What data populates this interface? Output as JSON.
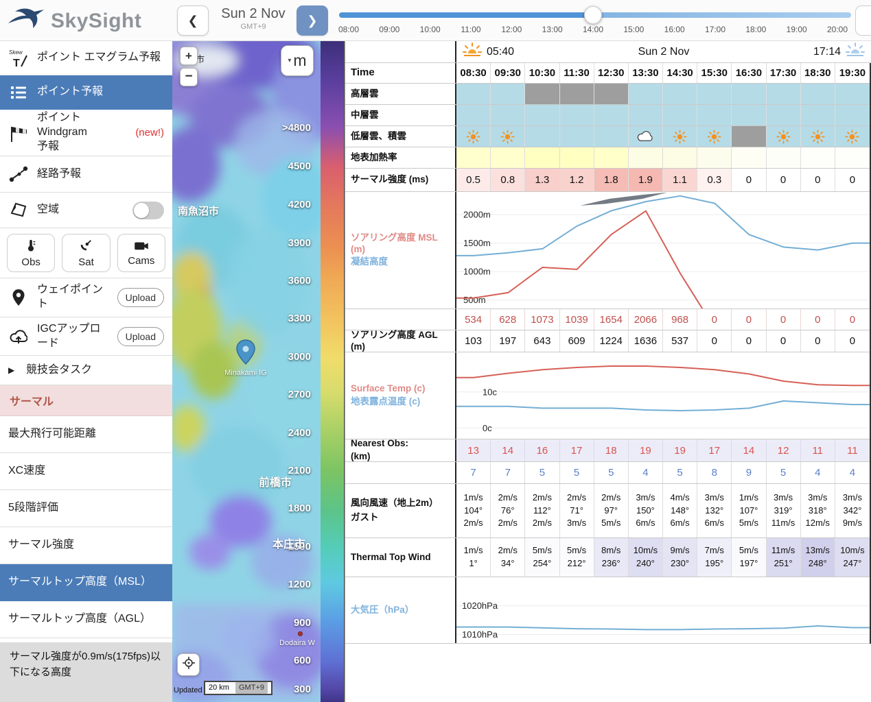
{
  "header": {
    "logo_text": "SkySight",
    "prev_label": "❮",
    "next_label": "❯",
    "date": "Sun 2 Nov",
    "timezone": "GMT+9",
    "slider": {
      "ticks": [
        "08:00",
        "09:00",
        "10:00",
        "11:00",
        "12:00",
        "13:00",
        "14:00",
        "15:00",
        "16:00",
        "17:00",
        "18:00",
        "19:00",
        "20:00"
      ],
      "value": "14:00"
    }
  },
  "sidebar": {
    "emagram": "ポイント エマグラム予報",
    "point_forecast": "ポイント予報",
    "windgram_line1": "ポイント Windgram",
    "windgram_line2": "予報",
    "windgram_new": "(new!)",
    "route": "経路予報",
    "airspace": "空域",
    "obs": "Obs",
    "sat": "Sat",
    "cams": "Cams",
    "waypoint": "ウェイポイント",
    "upload": "Upload",
    "igc": "IGCアップロード",
    "task_arrow": "▶",
    "task": "競技会タスク",
    "thermal_header": "サーマル",
    "max_distance": "最大飛行可能距離",
    "xc_speed": "XC速度",
    "rating": "5段階評価",
    "thermal_strength": "サーマル強度",
    "thermal_top_msl": "サーマルトップ高度（MSL）",
    "thermal_top_agl": "サーマルトップ高度（AGL）",
    "footer_note": "サーマル強度が0.9m/s(175fps)以下になる高度"
  },
  "map": {
    "zoom_in": "+",
    "zoom_out": "−",
    "unit_button": "m",
    "labels": {
      "city_top": "市",
      "minamiuonuma": "南魚沼市",
      "minakami": "Minakami IG",
      "maebashi": "前橋市",
      "honjo": "本庄市",
      "dodaira": "Dodaira W"
    },
    "updated_label": "Updated",
    "updated_chip": "GMT+9",
    "scalebar": "20 km",
    "scale_labels": [
      ">4800",
      "4500",
      "4200",
      "3900",
      "3600",
      "3300",
      "3000",
      "2700",
      "2400",
      "2100",
      "1800",
      "1500",
      "1200",
      "900",
      "600",
      "300"
    ]
  },
  "forecast": {
    "sunrise_time": "05:40",
    "date": "Sun 2 Nov",
    "sunset_time": "17:14",
    "times": [
      "08:30",
      "09:30",
      "10:30",
      "11:30",
      "12:30",
      "13:30",
      "14:30",
      "15:30",
      "16:30",
      "17:30",
      "18:30",
      "19:30"
    ],
    "rows": [
      {
        "key": "time",
        "height": 30,
        "cls": "time",
        "labels": [
          {
            "text": "Time",
            "size": 15
          }
        ],
        "use_times": true
      },
      {
        "key": "high_cloud",
        "height": 31,
        "labels": [
          {
            "text": "高層雲"
          }
        ],
        "cellbgs": [
          "#b5dbe7",
          "#b5dbe7",
          "#9e9e9e",
          "#9e9e9e",
          "#9e9e9e",
          "#b5dbe7",
          "#b5dbe7",
          "#b5dbe7",
          "#b5dbe7",
          "#b5dbe7",
          "#b5dbe7",
          "#b5dbe7"
        ]
      },
      {
        "key": "mid_cloud",
        "height": 31,
        "labels": [
          {
            "text": "中層雲"
          }
        ],
        "cellbgs": [
          "#b5dbe7",
          "#b5dbe7",
          "#b5dbe7",
          "#b5dbe7",
          "#b5dbe7",
          "#b5dbe7",
          "#b5dbe7",
          "#b5dbe7",
          "#b5dbe7",
          "#b5dbe7",
          "#b5dbe7",
          "#b5dbe7"
        ]
      },
      {
        "key": "low_cloud",
        "height": 31,
        "labels": [
          {
            "text": "低層雲、積雲"
          }
        ],
        "cellbgs": [
          "#b5dbe7",
          "#b5dbe7",
          "#b5dbe7",
          "#b5dbe7",
          "#b5dbe7",
          "#b5dbe7",
          "#b5dbe7",
          "#b5dbe7",
          "#9e9e9e",
          "#b5dbe7",
          "#b5dbe7",
          "#b5dbe7"
        ],
        "icons": [
          "sun",
          "sun",
          null,
          null,
          null,
          "cloud",
          "sun",
          "sun",
          null,
          "sun",
          "sun",
          "sun"
        ]
      },
      {
        "key": "heating",
        "height": 31,
        "labels": [
          {
            "text": "地表加熱率"
          }
        ],
        "cellbgs": [
          "#ffffce",
          "#ffffce",
          "#ffffc2",
          "#ffffc2",
          "#ffffca",
          "#fdfce4",
          "#fdfce4",
          "#fdfdee",
          "#fefef4",
          "#fefef8",
          "#fefefa",
          "#fefefa"
        ]
      },
      {
        "key": "strength",
        "height": 34,
        "cls": "vals",
        "labels": [
          {
            "text": "サーマル強度 (ms)"
          }
        ],
        "values": [
          "0.5",
          "0.8",
          "1.3",
          "1.2",
          "1.8",
          "1.9",
          "1.1",
          "0.3",
          "0",
          "0",
          "0",
          "0"
        ],
        "cellbgs": [
          "#fcebe9",
          "#fbe0dd",
          "#f8cfca",
          "#f9d2cd",
          "#f5bcb5",
          "#f5b9b2",
          "#f9d6d1",
          "#fdf2f0",
          "#ffffff",
          "#ffffff",
          "#ffffff",
          "#ffffff"
        ]
      },
      {
        "key": "soaring_chart",
        "type": "chart",
        "chart": "soaring",
        "height": 171,
        "labels": [
          {
            "text": "ソアリング高度 MSL (m)",
            "color": "#e08a85"
          },
          {
            "text": "凝結高度",
            "color": "#7fb2dd"
          }
        ]
      },
      {
        "key": "msl_values",
        "height": 31,
        "cls": "vals",
        "fg": "#c0504d",
        "border": "#ecd6d4",
        "labels": [],
        "values": [
          "534",
          "628",
          "1073",
          "1039",
          "1654",
          "2066",
          "968",
          "0",
          "0",
          "0",
          "0",
          "0"
        ]
      },
      {
        "key": "agl_values",
        "height": 32,
        "cls": "vals",
        "labels": [
          {
            "text": "ソアリング高度 AGL (m)"
          }
        ],
        "values": [
          "103",
          "197",
          "643",
          "609",
          "1224",
          "1636",
          "537",
          "0",
          "0",
          "0",
          "0",
          "0"
        ]
      },
      {
        "key": "temp_chart",
        "type": "chart",
        "chart": "temp",
        "height": 127,
        "labels": [
          {
            "text": "Surface Temp (c)",
            "color": "#e08a85"
          },
          {
            "text": "地表露点温度 (c)",
            "color": "#7fb2dd"
          }
        ]
      },
      {
        "key": "obs_red",
        "height": 33,
        "cls": "vals",
        "fg": "#d9534f",
        "bg": "#ececf8",
        "border": "#d9d9ea",
        "labels": [
          {
            "text": "Nearest Obs:"
          },
          {
            "text": "(km)"
          }
        ],
        "values": [
          "13",
          "14",
          "16",
          "17",
          "18",
          "19",
          "19",
          "17",
          "14",
          "12",
          "11",
          "11"
        ]
      },
      {
        "key": "obs_blue",
        "height": 32,
        "cls": "vals",
        "fg": "#5b7fc9",
        "labels": [],
        "values": [
          "7",
          "7",
          "5",
          "5",
          "5",
          "4",
          "5",
          "8",
          "9",
          "5",
          "4",
          "4"
        ]
      },
      {
        "key": "surface_wind",
        "height": 79,
        "cls": "small",
        "labels": [
          {
            "text": "風向風速（地上2m）"
          },
          {
            "text": " "
          },
          {
            "text": "ガスト"
          }
        ],
        "lines": [
          [
            "1m/s",
            "104°",
            "2m/s"
          ],
          [
            "2m/s",
            "76°",
            "2m/s"
          ],
          [
            "2m/s",
            "112°",
            "2m/s"
          ],
          [
            "2m/s",
            "71°",
            "3m/s"
          ],
          [
            "2m/s",
            "97°",
            "5m/s"
          ],
          [
            "3m/s",
            "150°",
            "6m/s"
          ],
          [
            "4m/s",
            "148°",
            "6m/s"
          ],
          [
            "3m/s",
            "132°",
            "6m/s"
          ],
          [
            "1m/s",
            "107°",
            "5m/s"
          ],
          [
            "3m/s",
            "319°",
            "11m/s"
          ],
          [
            "3m/s",
            "318°",
            "12m/s"
          ],
          [
            "3m/s",
            "342°",
            "9m/s"
          ]
        ]
      },
      {
        "key": "thermal_top_wind",
        "height": 57,
        "cls": "small",
        "labels": [
          {
            "text": "Thermal Top Wind"
          }
        ],
        "cellbgs": [
          "#ffffff",
          "#ffffff",
          "#fbfbfd",
          "#fbfbfd",
          "#e8e8f6",
          "#dedef2",
          "#e4e4f4",
          "#efeff9",
          "#fafafd",
          "#dadaf0",
          "#d0d0ec",
          "#dedef2"
        ],
        "lines": [
          [
            "1m/s",
            "1°"
          ],
          [
            "2m/s",
            "34°"
          ],
          [
            "5m/s",
            "254°"
          ],
          [
            "5m/s",
            "212°"
          ],
          [
            "8m/s",
            "236°"
          ],
          [
            "10m/s",
            "240°"
          ],
          [
            "9m/s",
            "230°"
          ],
          [
            "7m/s",
            "195°"
          ],
          [
            "5m/s",
            "197°"
          ],
          [
            "11m/s",
            "251°"
          ],
          [
            "13m/s",
            "248°"
          ],
          [
            "10m/s",
            "247°"
          ]
        ]
      },
      {
        "key": "pressure_chart",
        "type": "chart",
        "chart": "pressure",
        "height": 97,
        "labels": [
          {
            "text": "大気圧（hPa）",
            "color": "#7fb2dd"
          }
        ]
      }
    ]
  },
  "chart_data": [
    {
      "id": "soaring",
      "type": "line",
      "title": "ソアリング高度 MSL (m) / 凝結高度",
      "x": [
        "08:30",
        "09:30",
        "10:30",
        "11:30",
        "12:30",
        "13:30",
        "14:30",
        "15:30",
        "16:30",
        "17:30",
        "18:30",
        "19:30"
      ],
      "ylim": [
        350,
        2400
      ],
      "tick_x": 10,
      "yticks": [
        {
          "v": 2000,
          "label": "2000m"
        },
        {
          "v": 1500,
          "label": "1500m"
        },
        {
          "v": 1000,
          "label": "1000m"
        },
        {
          "v": 500,
          "label": "500m"
        }
      ],
      "series": [
        {
          "name": "凝結高度",
          "color": "#74aed4",
          "values": [
            1280,
            1330,
            1400,
            1800,
            2070,
            2230,
            2330,
            2200,
            1650,
            1430,
            1380,
            1500
          ]
        },
        {
          "name": "ソアリング高度 MSL (m)",
          "color": "#d65f57",
          "values": [
            534,
            628,
            1073,
            1039,
            1654,
            2066,
            968,
            0,
            0,
            0,
            0,
            0
          ]
        }
      ],
      "shade": {
        "color": "#5a646e",
        "points": [
          [
            0.3,
            2160
          ],
          [
            0.37,
            2280
          ],
          [
            0.45,
            2350
          ],
          [
            0.51,
            2390
          ],
          [
            0.45,
            2280
          ],
          [
            0.36,
            2190
          ]
        ]
      }
    },
    {
      "id": "temp",
      "type": "line",
      "title": "Surface Temp (c) / 地表露点温度 (c)",
      "x": [
        "08:30",
        "09:30",
        "10:30",
        "11:30",
        "12:30",
        "13:30",
        "14:30",
        "15:30",
        "16:30",
        "17:30",
        "18:30",
        "19:30"
      ],
      "ylim": [
        -3,
        21
      ],
      "tick_x": 38,
      "yticks": [
        {
          "v": 10,
          "label": "10c"
        },
        {
          "v": 0,
          "label": "0c"
        }
      ],
      "series": [
        {
          "name": "Surface Temp (c)",
          "color": "#d65f57",
          "values": [
            14,
            15.2,
            16.2,
            16.8,
            17.2,
            17.2,
            16.8,
            16.2,
            15,
            13,
            12,
            11.8
          ]
        },
        {
          "name": "地表露点温度 (c)",
          "color": "#74aed4",
          "values": [
            6,
            6,
            5.5,
            5.5,
            5.5,
            5,
            4.8,
            5,
            5.5,
            7.5,
            7,
            6.5
          ]
        }
      ]
    },
    {
      "id": "pressure",
      "type": "line",
      "title": "大気圧（hPa）",
      "x": [
        "08:30",
        "09:30",
        "10:30",
        "11:30",
        "12:30",
        "13:30",
        "14:30",
        "15:30",
        "16:30",
        "17:30",
        "18:30",
        "19:30"
      ],
      "ylim": [
        1007,
        1030
      ],
      "tick_x": 8,
      "yticks": [
        {
          "v": 1020,
          "label": "1020hPa"
        },
        {
          "v": 1010,
          "label": "1010hPa"
        }
      ],
      "series": [
        {
          "name": "大気圧（hPa）",
          "color": "#74aed4",
          "values": [
            1012.6,
            1012.6,
            1012.3,
            1012,
            1011.9,
            1011.7,
            1011.7,
            1011.9,
            1012,
            1012.2,
            1013,
            1012.4
          ]
        }
      ]
    }
  ]
}
